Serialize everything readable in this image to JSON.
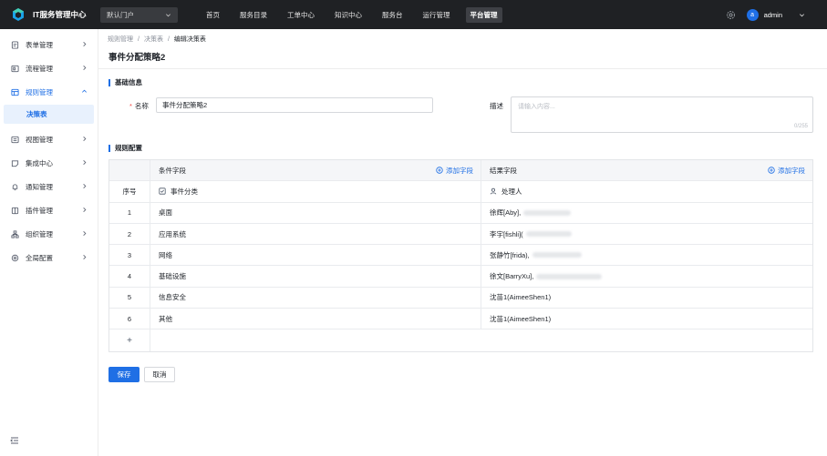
{
  "app": {
    "title": "IT服务管理中心",
    "portal_select": "默认门户",
    "brand_color": "#1f6fe5"
  },
  "nav": {
    "items": [
      {
        "label": "首页"
      },
      {
        "label": "服务目录"
      },
      {
        "label": "工单中心"
      },
      {
        "label": "知识中心"
      },
      {
        "label": "服务台"
      },
      {
        "label": "运行管理"
      },
      {
        "label": "平台管理",
        "active": true
      }
    ]
  },
  "user": {
    "avatar_letter": "a",
    "name": "admin"
  },
  "sidebar": {
    "items": [
      {
        "label": "表单管理",
        "icon": "form-icon"
      },
      {
        "label": "流程管理",
        "icon": "flow-icon"
      },
      {
        "label": "规则管理",
        "icon": "rule-icon",
        "open": true
      },
      {
        "label": "视图管理",
        "icon": "view-icon"
      },
      {
        "label": "集成中心",
        "icon": "integration-icon"
      },
      {
        "label": "通知管理",
        "icon": "bell-icon"
      },
      {
        "label": "插件管理",
        "icon": "plugin-icon"
      },
      {
        "label": "组织管理",
        "icon": "org-icon"
      },
      {
        "label": "全局配置",
        "icon": "settings-icon"
      }
    ],
    "sub_active": "决策表"
  },
  "breadcrumb": {
    "items": [
      "规则管理",
      "决策表",
      "编辑决策表"
    ]
  },
  "page": {
    "title": "事件分配策略2"
  },
  "basic": {
    "section_title": "基础信息",
    "name_label": "名称",
    "name_value": "事件分配策略2",
    "desc_label": "描述",
    "desc_placeholder": "请输入内容...",
    "desc_counter": "0/255"
  },
  "rules": {
    "section_title": "规则配置",
    "cond_header": "条件字段",
    "result_header": "结果字段",
    "add_field": "添加字段",
    "index_header": "序号",
    "cond_field": "事件分类",
    "result_field": "处理人",
    "rows": [
      {
        "index": "1",
        "condition": "桌面",
        "result": "徐辉[Aby],"
      },
      {
        "index": "2",
        "condition": "应用系统",
        "result": "李宇[fishli]("
      },
      {
        "index": "3",
        "condition": "网络",
        "result": "张静竹[frida),"
      },
      {
        "index": "4",
        "condition": "基础设施",
        "result": "徐文[BarryXu],"
      },
      {
        "index": "5",
        "condition": "信息安全",
        "result": "沈苗1(AimeeShen1)"
      },
      {
        "index": "6",
        "condition": "其他",
        "result": "沈苗1(AimeeShen1)"
      }
    ],
    "add_row": "+"
  },
  "actions": {
    "save": "保存",
    "cancel": "取消"
  }
}
